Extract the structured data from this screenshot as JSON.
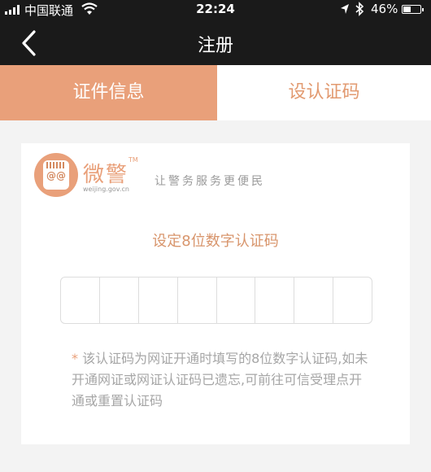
{
  "status_bar": {
    "carrier": "中国联通",
    "time": "22:24",
    "battery_pct": "46%",
    "battery_level": 0.46
  },
  "nav": {
    "title": "注册"
  },
  "tabs": [
    {
      "label": "证件信息",
      "active": true
    },
    {
      "label": "设认证码",
      "active": false
    }
  ],
  "brand": {
    "logo_text": "微警",
    "logo_tm": "TM",
    "logo_url": "weijing.gov.cn",
    "slogan": "让警务服务更便民"
  },
  "form": {
    "heading": "设定8位数字认证码",
    "code_length": 8,
    "note_star": "*",
    "note": "该认证码为网证开通时填写的8位数字认证码,如未开通网证或网证认证码已遗忘,可前往可信受理点开通或重置认证码"
  },
  "colors": {
    "accent": "#e9a07a",
    "header_bg": "#1a1a1a",
    "inactive_tab_text": "#e29a70",
    "page_bg": "#f3f3f3"
  }
}
